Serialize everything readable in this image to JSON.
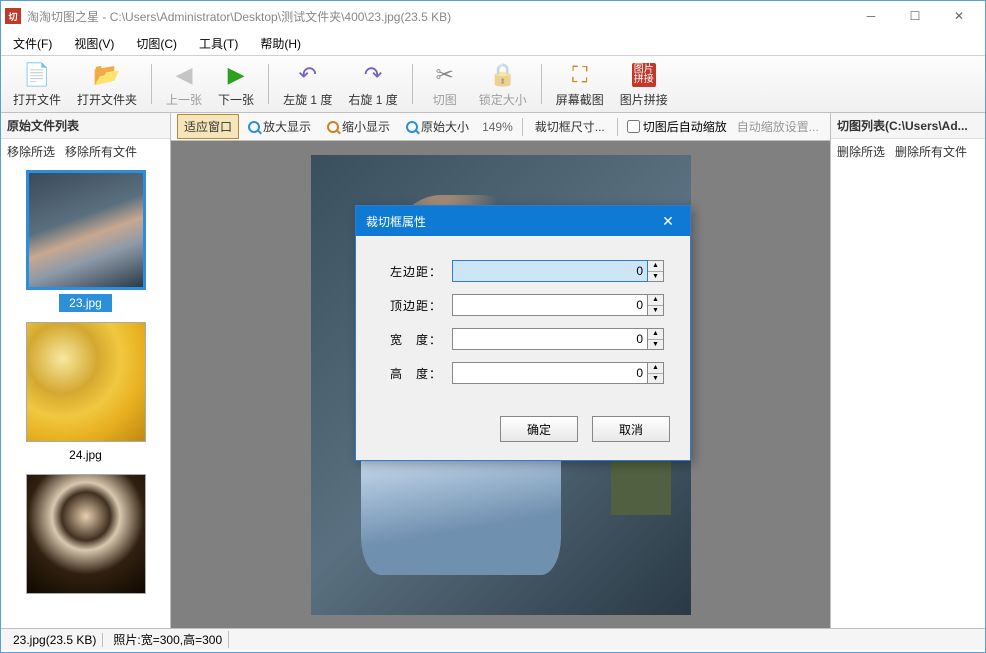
{
  "titlebar": {
    "app_name": "淘淘切图之星",
    "path": "C:\\Users\\Administrator\\Desktop\\测试文件夹\\400\\23.jpg(23.5 KB)"
  },
  "menu": {
    "file": "文件(F)",
    "view": "视图(V)",
    "crop": "切图(C)",
    "tools": "工具(T)",
    "help": "帮助(H)"
  },
  "toolbar": {
    "open_file": "打开文件",
    "open_folder": "打开文件夹",
    "prev": "上一张",
    "next": "下一张",
    "rotate_left": "左旋 1 度",
    "rotate_right": "右旋 1 度",
    "crop": "切图",
    "lock_size": "锁定大小",
    "screenshot": "屏幕截图",
    "image_join": "图片拼接"
  },
  "subtoolbar": {
    "fit_window": "适应窗口",
    "zoom_in": "放大显示",
    "zoom_out": "缩小显示",
    "original_size": "原始大小",
    "zoom_level": "149%",
    "crop_size": "裁切框尺寸...",
    "auto_zoom_after_crop": "切图后自动缩放",
    "auto_zoom_settings": "自动缩放设置..."
  },
  "left_panel": {
    "title": "原始文件列表",
    "remove_selected": "移除所选",
    "remove_all": "移除所有文件",
    "thumbs": [
      {
        "name": "23.jpg",
        "selected": true
      },
      {
        "name": "24.jpg",
        "selected": false
      },
      {
        "name": "",
        "selected": false
      }
    ]
  },
  "right_panel": {
    "title": "切图列表(C:\\Users\\Ad...",
    "remove_selected": "删除所选",
    "remove_all": "删除所有文件"
  },
  "dialog": {
    "title": "裁切框属性",
    "left_margin_label": "左边距：",
    "top_margin_label": "顶边距：",
    "width_label": "宽　度：",
    "height_label": "高　度：",
    "left_margin": "0",
    "top_margin": "0",
    "width": "0",
    "height": "0",
    "ok": "确定",
    "cancel": "取消"
  },
  "statusbar": {
    "file_info": "23.jpg(23.5 KB)",
    "dimensions": "照片:宽=300,高=300"
  }
}
